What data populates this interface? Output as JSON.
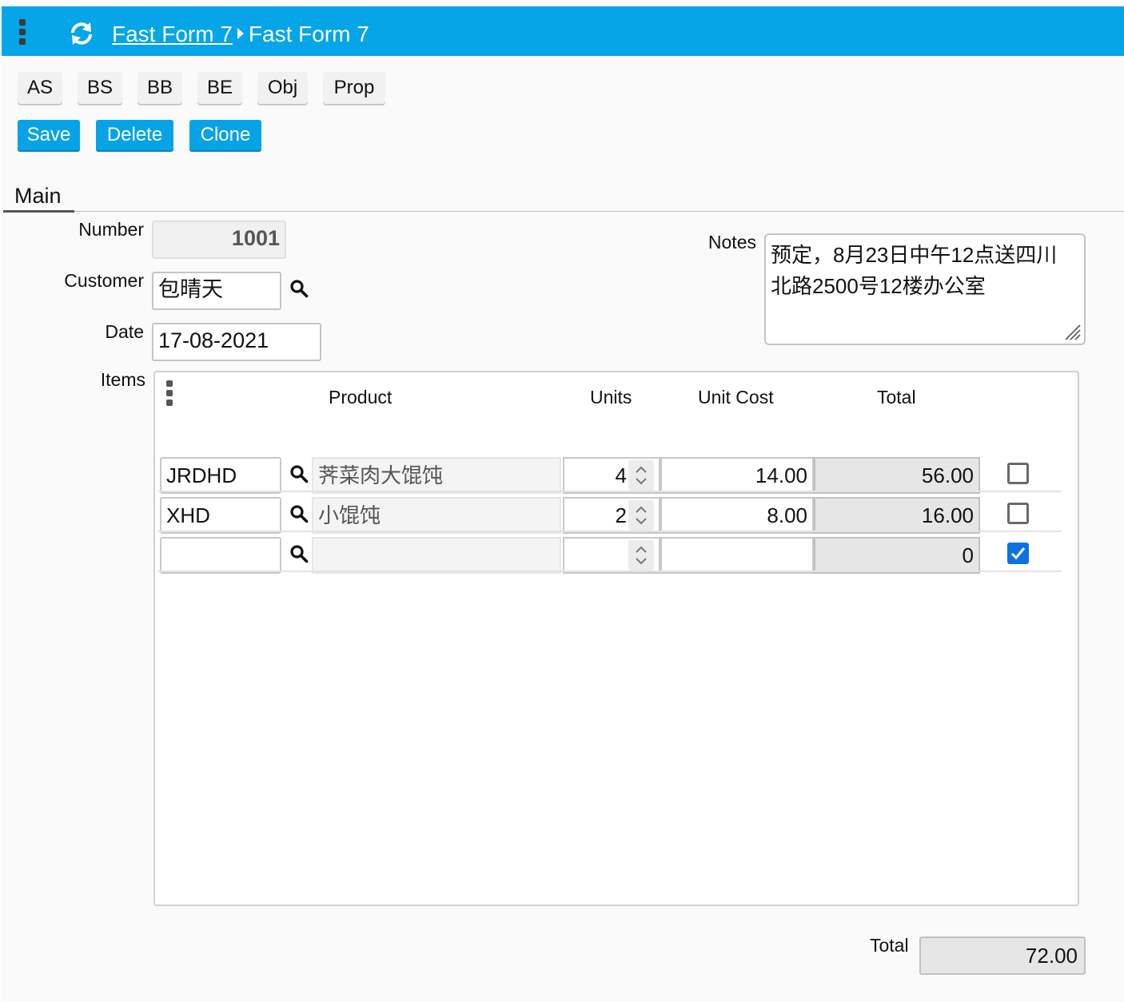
{
  "header": {
    "breadcrumb": [
      "Fast Form 7",
      "Fast Form 7"
    ]
  },
  "toolbar": {
    "buttons": [
      "AS",
      "BS",
      "BB",
      "BE",
      "Obj",
      "Prop"
    ]
  },
  "actions": {
    "save": "Save",
    "delete": "Delete",
    "clone": "Clone"
  },
  "tabs": [
    "Main"
  ],
  "form": {
    "number_label": "Number",
    "number": "1001",
    "customer_label": "Customer",
    "customer": "包晴天",
    "date_label": "Date",
    "date": "17-08-2021",
    "notes_label": "Notes",
    "notes_line1": "预定，8月23日中午12点送四川",
    "notes_line2": "北路2500号12楼办公室",
    "items_label": "Items",
    "total_label": "Total",
    "total": "72.00"
  },
  "items": {
    "columns": [
      "Product",
      "Units",
      "Unit Cost",
      "Total"
    ],
    "rows": [
      {
        "code": "JRDHD",
        "product": "荠菜肉大馄饨",
        "units": "4",
        "unit_cost": "14.00",
        "total": "56.00",
        "checked": false
      },
      {
        "code": "XHD",
        "product": "小馄饨",
        "units": "2",
        "unit_cost": "8.00",
        "total": "16.00",
        "checked": false
      },
      {
        "code": "",
        "product": "",
        "units": "",
        "unit_cost": "",
        "total": "0",
        "checked": true
      }
    ]
  },
  "colors": {
    "header_bg": "#05a5e8",
    "action_button": "#08a3e6",
    "checkbox_checked": "#0a73e0"
  },
  "icons": [
    "kebab-menu-icon",
    "refresh-icon",
    "search-icon",
    "resize-handle-icon",
    "spinner-arrows-icon",
    "checkmark-icon"
  ]
}
